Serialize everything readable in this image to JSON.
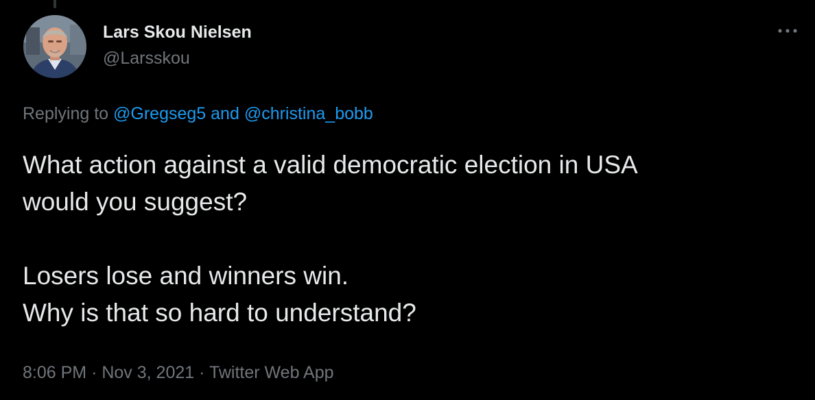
{
  "author": {
    "display_name": "Lars Skou Nielsen",
    "handle": "@Larsskou",
    "avatar_icon": "profile-photo"
  },
  "more_icon": "ellipsis-icon",
  "reply_context": {
    "prefix": "Replying to",
    "mention_1": "@Gregseg5",
    "conjunction": "and",
    "mention_2": "@christina_bobb"
  },
  "tweet": {
    "line_1": "What action against a valid democratic election in USA",
    "line_2": "would you suggest?",
    "line_3": "Losers lose and winners win.",
    "line_4": "Why is that so hard to understand?"
  },
  "meta": {
    "time": "8:06 PM",
    "separator": "·",
    "date": "Nov 3, 2021",
    "source": "Twitter Web App"
  },
  "colors": {
    "background": "#000000",
    "primary_text": "#e7e9ea",
    "secondary_text": "#71767b",
    "link": "#1d9bf0"
  }
}
